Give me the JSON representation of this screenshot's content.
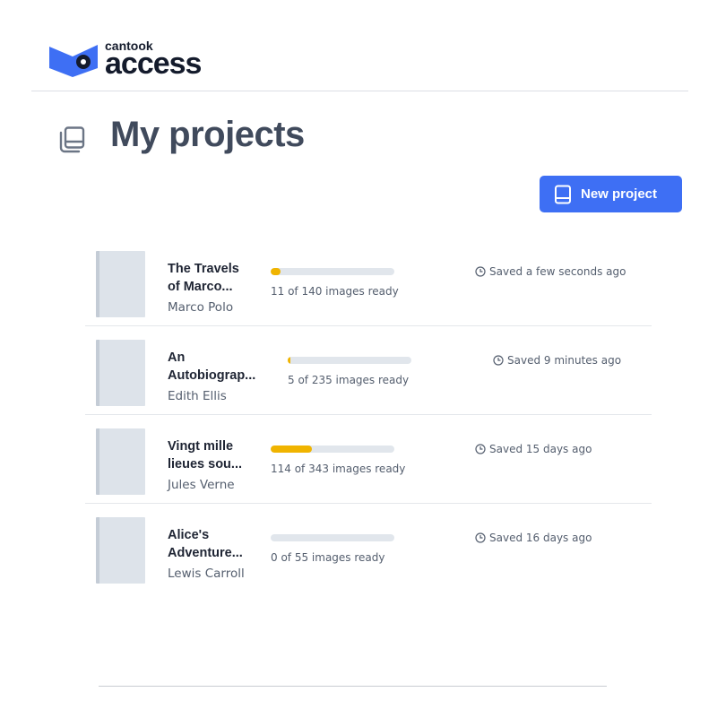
{
  "brand": {
    "name_small": "cantook",
    "name_big": "access",
    "logo_colors": {
      "blue": "#3e6ff4",
      "dark": "#141b2c"
    }
  },
  "page": {
    "title": "My projects",
    "title_icon": "books-stack-icon"
  },
  "actions": {
    "new_project_label": "New project",
    "new_project_icon": "book-icon",
    "accent_color": "#3e6ff4"
  },
  "projects": [
    {
      "title_line1": "The Travels",
      "title_line2": "of Marco...",
      "author": "Marco Polo",
      "progress_text": "11 of 140 images ready",
      "progress_fraction": 0.079,
      "saved": "Saved a few seconds ago"
    },
    {
      "title_line1": "An",
      "title_line2": "Autobiograp...",
      "author": "Edith Ellis",
      "progress_text": "5 of 235 images ready",
      "progress_fraction": 0.021,
      "saved": "Saved 9 minutes ago"
    },
    {
      "title_line1": "Vingt mille",
      "title_line2": "lieues sou...",
      "author": "Jules Verne",
      "progress_text": "114 of 343 images ready",
      "progress_fraction": 0.332,
      "saved": "Saved 15 days ago"
    },
    {
      "title_line1": "Alice's",
      "title_line2": "Adventure...",
      "author": "Lewis Carroll",
      "progress_text": "0 of 55 images ready",
      "progress_fraction": 0.0,
      "saved": "Saved 16 days ago"
    }
  ],
  "status_icon": "clock-icon",
  "progress_color": "#f0b400"
}
